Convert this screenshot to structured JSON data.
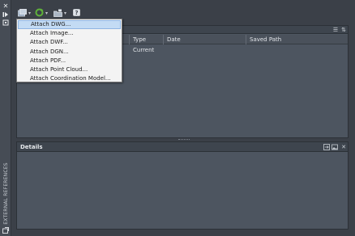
{
  "palette": {
    "menu_bg": "#f3f3f3",
    "menu_highlight": "#c3dbf4",
    "panel_bg": "#4d5560",
    "window_bg": "#3b4048",
    "refresh_green": "#5fb23a"
  },
  "strip": {
    "icons": [
      "close-icon",
      "auto-hide-icon",
      "properties-icon",
      "palette-icon"
    ],
    "vertical_title": "EXTERNAL REFERENCES"
  },
  "toolbar": {
    "icons": [
      "attach-icon",
      "refresh-icon",
      "change-path-icon",
      "help-icon"
    ]
  },
  "file_references": {
    "columns": [
      "Type",
      "Date",
      "Saved Path"
    ],
    "rows": [
      {
        "type": "Current",
        "date": "",
        "saved_path": ""
      }
    ],
    "view_icons": [
      "list-view-icon",
      "tree-view-icon"
    ]
  },
  "details": {
    "title": "Details",
    "icons": [
      "details-icon",
      "preview-icon",
      "close-icon"
    ]
  },
  "attach_menu": {
    "items": [
      "Attach DWG...",
      "Attach Image...",
      "Attach DWF...",
      "Attach DGN...",
      "Attach PDF...",
      "Attach Point Cloud...",
      "Attach Coordination Model..."
    ],
    "selected_index": 0
  }
}
